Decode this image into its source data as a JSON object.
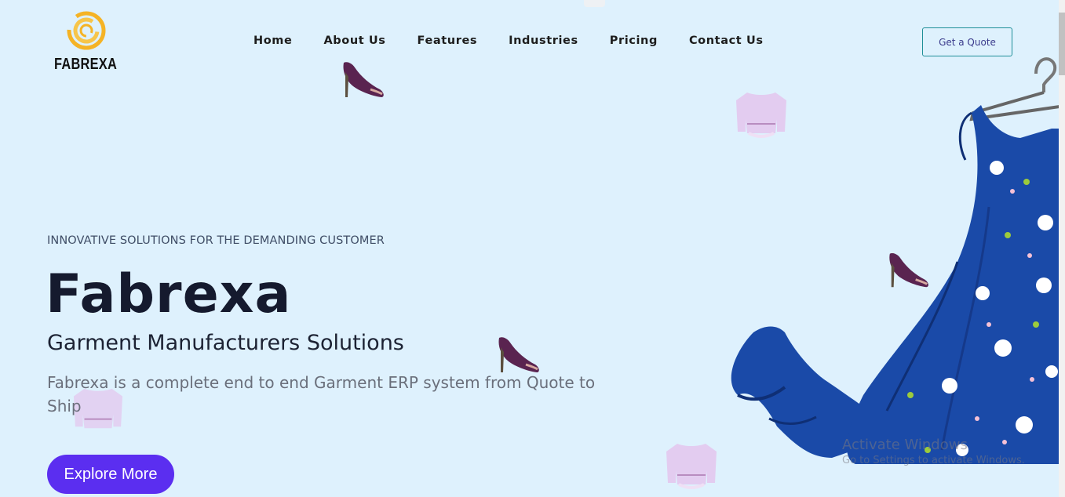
{
  "brand": {
    "name": "FABREXA"
  },
  "nav": {
    "items": [
      "Home",
      "About Us",
      "Features",
      "Industries",
      "Pricing",
      "Contact Us"
    ]
  },
  "header": {
    "quote_label": "Get a Quote"
  },
  "hero": {
    "eyebrow": "INNOVATIVE SOLUTIONS FOR THE DEMANDING CUSTOMER",
    "title": "Fabrexa",
    "subtitle": "Garment Manufacturers Solutions",
    "description": "Fabrexa is a complete end to end Garment ERP system from Quote to Ship",
    "cta_label": "Explore More"
  },
  "os_overlay": {
    "title": "Activate Windows",
    "subtitle": "Go to Settings to activate Windows."
  },
  "colors": {
    "background": "#def1fd",
    "accent": "#5b2ef0",
    "logo": "#f5b325",
    "dress": "#1a4aa8"
  }
}
